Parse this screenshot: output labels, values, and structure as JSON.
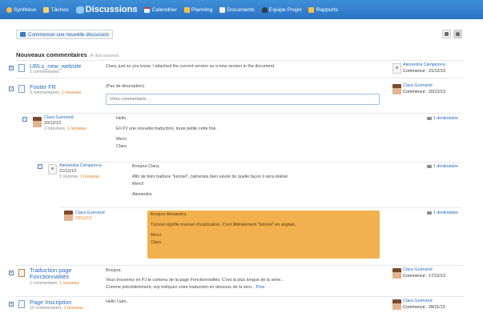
{
  "nav": {
    "items": [
      {
        "label": "Synthèse",
        "icon": "synthesis-icon",
        "color": "#f5c04a"
      },
      {
        "label": "Tâches",
        "icon": "tasks-icon",
        "color": "#f7d36b"
      },
      {
        "label": "Discussions",
        "icon": "discussions-icon",
        "color": "#8fc7ff"
      },
      {
        "label": "Calendrier",
        "icon": "calendar-icon",
        "color": "#f3f3f3"
      },
      {
        "label": "Planning",
        "icon": "planning-icon",
        "color": "#f5c04a"
      },
      {
        "label": "Documents",
        "icon": "documents-icon",
        "color": "#f3f3f3"
      },
      {
        "label": "Equipe Projet",
        "icon": "team-icon",
        "color": "#2b3e55"
      },
      {
        "label": "Rapports",
        "icon": "reports-icon",
        "color": "#f5c04a"
      }
    ]
  },
  "toolbar": {
    "new_discussion": "Commencer une nouvelle discussion"
  },
  "section": {
    "title": "Nouveaux commentaires",
    "count": "(4 discussions)"
  },
  "topics": [
    {
      "title": "URLs_new_website",
      "comments": "2 commentaires",
      "text": "Clara, just so you know. I attached the current version as a new version in the document.",
      "author": "Alexandra Cienjanova",
      "started": "Commencé : 21/12/13"
    },
    {
      "title": "Footer FR",
      "comments": "3 commentaires,",
      "new": "1 nouveau",
      "text": "(Pas de description)",
      "placeholder": "Votre commentaire...",
      "author": "Clara Guénand",
      "started": "Commencé : 20/12/13",
      "replies": [
        {
          "author": "Clara Guénand",
          "date": "20/12/13",
          "meta": "2 réponses,",
          "new": "1 nouveau",
          "recipients": "1 destinataire",
          "lines": [
            "Hello,",
            "En PJ une nouvelle traduction, toute petite cette fois.",
            "Merci",
            "Clara"
          ]
        },
        {
          "author": "Alexandra Cienjanova",
          "date": "21/12/13",
          "meta": "1 réponse,",
          "new": "1 nouveau",
          "recipients": "1 destinataire",
          "lines": [
            "Bonjour Clara,",
            "Afin de bien traduire \"tutoriel\", j'aimerais bien savoir de quelle façon il sera réalisé",
            "Merci!",
            "Alexandra"
          ]
        },
        {
          "author": "Clara Guénand",
          "date": "23/12/13",
          "recipients": "1 destinataire",
          "lines": [
            "Bonjour Alexandra,",
            "Tutorial signifie manuel d'explication. C'est littéralement \"tutorial\" en anglais.",
            "Merci",
            "Clara"
          ]
        }
      ]
    },
    {
      "title_line1": "Traduction page",
      "title_line2": "Fonctionnalités",
      "comments": "1 commentaire,",
      "new": "1 nouveau",
      "text_line1": "Bonjour,",
      "text_line2": "Vous trouverez en PJ le contenu de la page Fonctionnalités. C'est la plus longue de la série...",
      "text_line3": "Comme précédemment, svp indiquez votre traduction en dessous de la vers...",
      "more": "Plus",
      "author": "Clara Guénand",
      "started": "Commencé : 17/12/13"
    },
    {
      "title": "Page Inscription",
      "comments": "10 commentaires,",
      "new": "1 nouveau",
      "text": "Hello Liam,",
      "author": "Clara Guénand",
      "started": "Commencé : 28/11/13"
    }
  ]
}
